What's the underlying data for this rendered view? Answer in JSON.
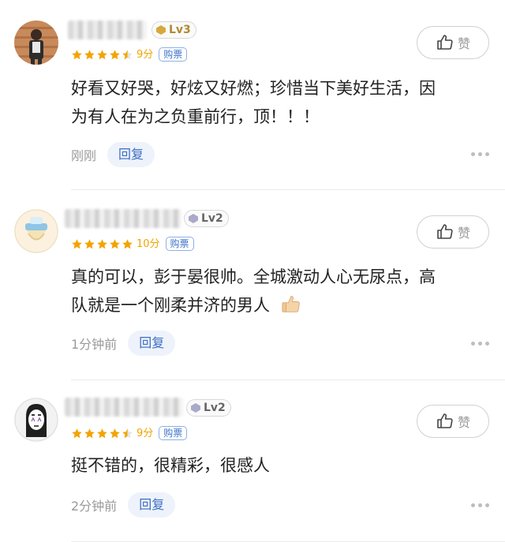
{
  "comments": [
    {
      "level": "Lv3",
      "rating_stars": 4.5,
      "score": "9分",
      "ticket": "购票",
      "like_label": "赞",
      "text_lines": [
        "好看又好哭，好炫又好燃；珍惜当下美好生活，因",
        "为有人在为之负重前行，顶！！！"
      ],
      "time": "刚刚",
      "reply_label": "回复"
    },
    {
      "level": "Lv2",
      "rating_stars": 5,
      "score": "10分",
      "ticket": "购票",
      "like_label": "赞",
      "text_lines": [
        "真的可以，彭于晏很帅。全城激动人心无尿点，高",
        "队就是一个刚柔并济的男人"
      ],
      "time": "1分钟前",
      "reply_label": "回复"
    },
    {
      "level": "Lv2",
      "rating_stars": 4.5,
      "score": "9分",
      "ticket": "购票",
      "like_label": "赞",
      "text_lines": [
        "挺不错的，很精彩，很感人"
      ],
      "time": "2分钟前",
      "reply_label": "回复"
    }
  ],
  "colors": {
    "star": "#f2a400",
    "ticket": "#3f74c9",
    "reply_bg": "#eef2fb",
    "gold_level": "#b08a2e"
  },
  "icons": {
    "like": "thumbs-up-icon",
    "more": "more-dots-icon",
    "emoji": "thumbs-up-emoji-icon"
  }
}
